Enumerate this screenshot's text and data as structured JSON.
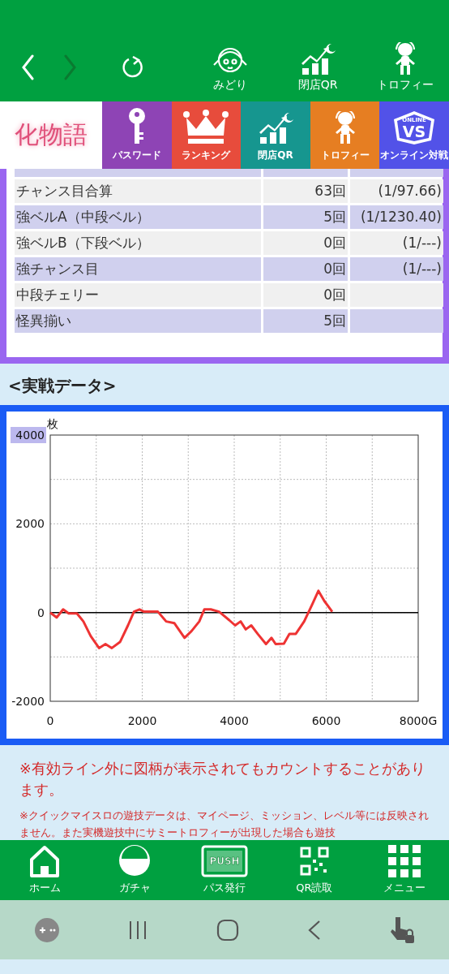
{
  "nav_buttons": [
    {
      "kind": "back",
      "disabled": false
    },
    {
      "kind": "forward",
      "disabled": true
    },
    {
      "kind": "reload",
      "disabled": false
    }
  ],
  "header_links": [
    {
      "label": "みどり",
      "kind": "character"
    },
    {
      "label": "閉店QR",
      "kind": "chart"
    },
    {
      "label": "トロフィー",
      "kind": "alien"
    }
  ],
  "logo": {
    "text": "化物語"
  },
  "tabs": [
    {
      "label": "パスワード",
      "kind": "key",
      "color": "#8e44b5"
    },
    {
      "label": "ランキング",
      "kind": "crown",
      "color": "#e74c3c"
    },
    {
      "label": "閉店QR",
      "kind": "chart",
      "color": "#16968f"
    },
    {
      "label": "トロフィー",
      "kind": "alien",
      "color": "#e67e22"
    },
    {
      "label": "オンライン対戦",
      "kind": "vs",
      "color": "#5252e8",
      "emblem_top": "ONLINE",
      "emblem_main": "VS"
    }
  ],
  "stats": [
    {
      "name": "チャンス目合算",
      "count": "63回",
      "ratio": "(1/97.66)"
    },
    {
      "name": "強ベルA（中段ベル）",
      "count": "5回",
      "ratio": "(1/1230.40)"
    },
    {
      "name": "強ベルB（下段ベル）",
      "count": "0回",
      "ratio": "(1/---)"
    },
    {
      "name": "強チャンス目",
      "count": "0回",
      "ratio": "(1/---)"
    },
    {
      "name": "中段チェリー",
      "count": "0回"
    },
    {
      "name": "怪異揃い",
      "count": "5回"
    }
  ],
  "section_title": "<実戦データ>",
  "chart_data": {
    "type": "line",
    "ylabel": "枚",
    "xlim": [
      0,
      8000
    ],
    "ylim": [
      -2000,
      4000
    ],
    "xticks": [
      0,
      2000,
      4000,
      6000,
      {
        "value": 8000,
        "label": "8000G"
      }
    ],
    "yticks": [
      -2000,
      0,
      2000,
      4000
    ],
    "x": [
      0,
      140,
      280,
      400,
      580,
      720,
      880,
      1060,
      1200,
      1340,
      1520,
      1690,
      1820,
      1940,
      2040,
      2340,
      2520,
      2700,
      2920,
      3070,
      3240,
      3350,
      3490,
      3670,
      3890,
      4020,
      4140,
      4250,
      4370,
      4510,
      4690,
      4810,
      4900,
      5080,
      5200,
      5340,
      5520,
      5690,
      5830,
      5960,
      6130
    ],
    "grid": true,
    "series": [
      {
        "color": "#ee3333",
        "values": [
          0,
          -110,
          70,
          -20,
          -20,
          -200,
          -530,
          -800,
          -710,
          -800,
          -660,
          -290,
          20,
          70,
          20,
          20,
          -200,
          -240,
          -570,
          -420,
          -200,
          70,
          70,
          20,
          -170,
          -290,
          -200,
          -380,
          -290,
          -480,
          -710,
          -570,
          -710,
          -700,
          -480,
          -480,
          -200,
          170,
          490,
          260,
          20
        ]
      }
    ]
  },
  "notes": [
    {
      "kind": "main",
      "text": "※有効ライン外に図柄が表示されてもカウントすることがあります。"
    },
    {
      "kind": "sub",
      "text": "※クイックマイスロの遊技データは、マイページ、ミッション、レベル等には反映されません。また実機遊技中にサミートロフィーが出現した場合も遊技"
    }
  ],
  "bottom_nav": [
    {
      "label": "ホーム",
      "kind": "home"
    },
    {
      "label": "ガチャ",
      "kind": "gacha"
    },
    {
      "label": "パス発行",
      "kind": "push",
      "icon_text": "PUSH"
    },
    {
      "label": "QR読取",
      "kind": "qr"
    },
    {
      "label": "メニュー",
      "kind": "menu"
    }
  ]
}
